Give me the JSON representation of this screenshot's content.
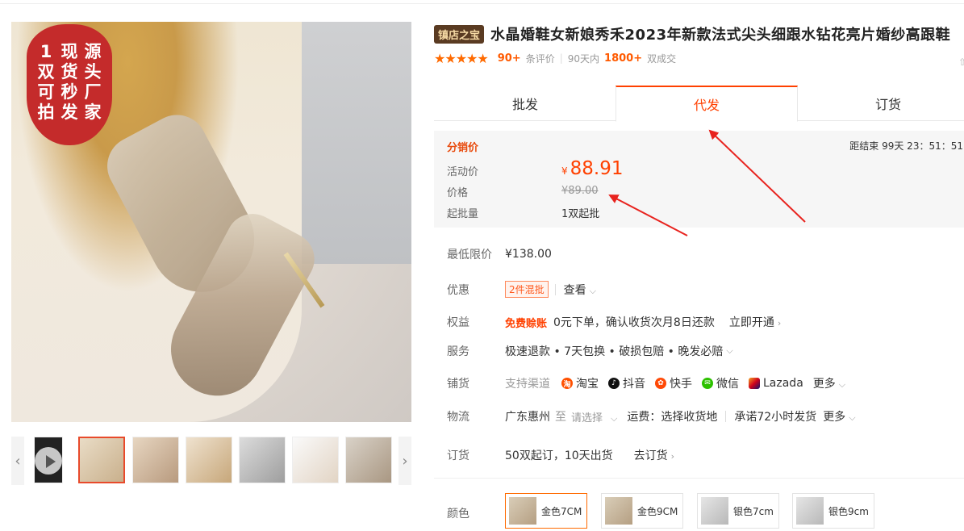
{
  "badge": {
    "cols": [
      [
        "1",
        "双",
        "可",
        "拍"
      ],
      [
        "现",
        "货",
        "秒",
        "发"
      ],
      [
        "源",
        "头",
        "厂",
        "家"
      ]
    ]
  },
  "product": {
    "tag": "镇店之宝",
    "title": "水晶婚鞋女新娘秀禾2023年新款法式尖头细跟水钻花亮片婚纱高跟鞋",
    "review_count": "90+",
    "review_label": "条评价",
    "sales_prefix": "90天内",
    "sales_count": "1800+",
    "sales_label": "双成交"
  },
  "tabs": [
    "批发",
    "代发",
    "订货"
  ],
  "price_box": {
    "title": "分销价",
    "countdown": "距结束  99天 23：51：51",
    "activity_label": "活动价",
    "currency": "¥",
    "activity_price": "88.91",
    "price_label": "价格",
    "original_price": "¥89.00",
    "moq_label": "起批量",
    "moq": "1双起批"
  },
  "rows": {
    "min_price": {
      "label": "最低限价",
      "value": "¥138.00"
    },
    "discount": {
      "label": "优惠",
      "pill": "2件混批",
      "link": "查看"
    },
    "rights": {
      "label": "权益",
      "highlight": "免费赊账",
      "text": "0元下单，确认收货次月8日还款",
      "link": "立即开通"
    },
    "service": {
      "label": "服务",
      "text": "极速退款 • 7天包换 • 破损包赔 • 晚发必赔"
    },
    "channels": {
      "label": "铺货",
      "prefix": "支持渠道",
      "items": [
        "淘宝",
        "抖音",
        "快手",
        "微信",
        "Lazada"
      ],
      "more": "更多"
    },
    "logistics": {
      "label": "物流",
      "from": "广东惠州",
      "to": "至",
      "select": "请选择",
      "fee": "运费：选择收货地",
      "promise": "承诺72小时发货",
      "more": "更多"
    },
    "order": {
      "label": "订货",
      "text": "50双起订，10天出货",
      "link": "去订货"
    }
  },
  "color": {
    "label": "颜色",
    "options": [
      "金色7CM",
      "金色9CM",
      "银色7cm",
      "银色9cm"
    ]
  },
  "colors": {
    "accent": "#ff4000",
    "tag_bg": "#5a3b22",
    "badge": "#c42b2b",
    "arrow": "#e8231e"
  }
}
